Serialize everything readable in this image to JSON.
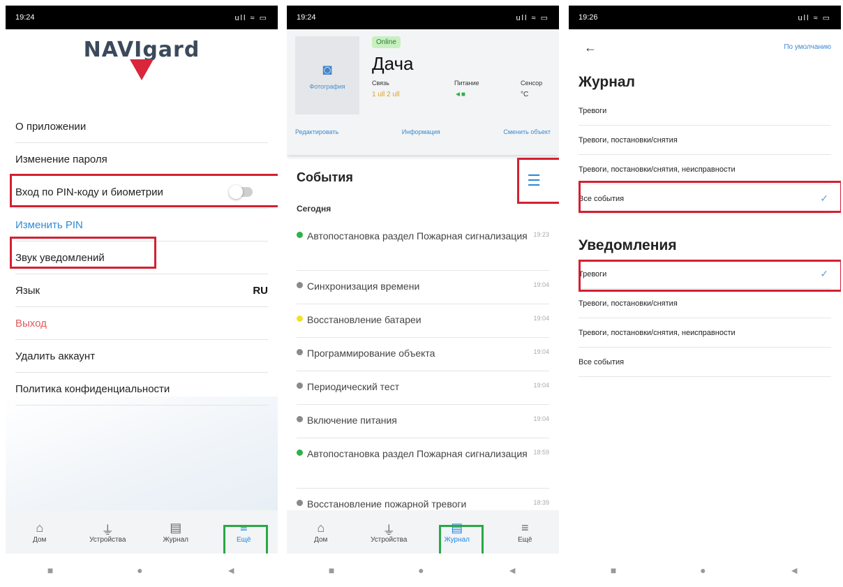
{
  "status_bar": {
    "p1_time": "19:24",
    "p2_time": "19:24",
    "p3_time": "19:26",
    "icons": "ull ≈ ▭"
  },
  "colors": {
    "accent": "#1e88e5",
    "highlight_red": "#d32032",
    "highlight_green": "#29a845",
    "logout_red": "#e05a5a"
  },
  "phone1": {
    "logo_text": "NAVIgard",
    "menu": {
      "about": "О приложении",
      "change_password": "Изменение пароля",
      "pin_login": "Вход по PIN-коду и биометрии",
      "change_pin": "Изменить PIN",
      "notif_sound": "Звук уведомлений",
      "language": "Язык",
      "language_value": "RU",
      "logout": "Выход",
      "delete_account": "Удалить аккаунт",
      "privacy": "Политика конфиденциальности"
    },
    "pin_toggle_on": false
  },
  "phone2": {
    "photo_label": "Фотография",
    "online_badge": "Online",
    "object_name": "Дача",
    "stats": {
      "link_label": "Связь",
      "link_value": "1 ull  2 ull",
      "power_label": "Питание",
      "power_value": "◄■",
      "sensor_label": "Сенсор",
      "sensor_value": "°C"
    },
    "actions": {
      "edit": "Редактировать",
      "info": "Информация",
      "change": "Сменить объект"
    },
    "events_title": "События",
    "today": "Сегодня",
    "events": [
      {
        "text": "Автопостановка раздел Пожарная сигнализация",
        "time": "19:23",
        "color": "#2bb34a"
      },
      {
        "text": "Синхронизация времени",
        "time": "19:04",
        "color": "#8a8a8a"
      },
      {
        "text": "Восстановление батареи",
        "time": "19:04",
        "color": "#f2e22a"
      },
      {
        "text": "Программирование объекта",
        "time": "19:04",
        "color": "#8a8a8a"
      },
      {
        "text": "Периодический тест",
        "time": "19:04",
        "color": "#8a8a8a"
      },
      {
        "text": "Включение питания",
        "time": "19:04",
        "color": "#8a8a8a"
      },
      {
        "text": "Автопостановка раздел Пожарная сигнализация",
        "time": "18:59",
        "color": "#2bb34a"
      },
      {
        "text": "Восстановление пожарной тревоги",
        "time": "18:39",
        "color": "#8a8a8a"
      }
    ]
  },
  "phone3": {
    "default_link": "По умолчанию",
    "journal_title": "Журнал",
    "notif_title": "Уведомления",
    "options": {
      "alarms": "Тревоги",
      "alarms_arm": "Тревоги, постановки/снятия",
      "alarms_arm_fault": "Тревоги, постановки/снятия, неисправности",
      "all": "Все события"
    },
    "journal_selected": "Все события",
    "notif_selected": "Тревоги"
  },
  "bottom_nav": {
    "home": "Дом",
    "devices": "Устройства",
    "journal": "Журнал",
    "more": "Ещё"
  },
  "icons": {
    "home": "home-icon",
    "devices": "plug-icon",
    "journal": "document-icon",
    "more": "menu-icon"
  }
}
